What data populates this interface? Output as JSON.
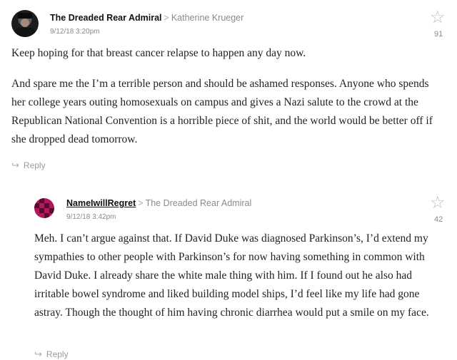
{
  "comments": [
    {
      "author": "The Dreaded Rear Admiral",
      "reply_to": "Katherine Krueger",
      "timestamp": "9/12/18 3:20pm",
      "votes": "91",
      "paragraphs": [
        "Keep hoping for that breast cancer relapse to happen any day now.",
        "And spare me the I’m a terrible person and should be ashamed responses. Anyone who spends her college years outing homosexuals on campus and gives a Nazi salute to the crowd at the Republican National Convention is a horrible piece of shit, and the world would be better off if she dropped dead tomorrow."
      ],
      "reply_label": "Reply"
    },
    {
      "author": "NameIwillRegret",
      "reply_to": "The Dreaded Rear Admiral",
      "timestamp": "9/12/18 3:42pm",
      "votes": "42",
      "paragraphs": [
        "Meh. I can’t argue against that. If David Duke was diagnosed Parkinson’s, I’d extend my sympathies to other people with Parkinson’s for now having something in common with David Duke. I already share the white male thing with him. If I found out he also had irritable bowel syndrome and liked building model ships, I’d feel like my life had gone astray. Though the thought of him having chronic diarrhea would put a smile on my face."
      ],
      "reply_label": "Reply"
    }
  ],
  "icons": {
    "star": "star-outline-icon",
    "reply": "reply-arrow-icon",
    "chevron": "chevron-right-icon"
  },
  "colors": {
    "avatar2": "#b0185f",
    "meta_text": "#8a8a8a"
  }
}
